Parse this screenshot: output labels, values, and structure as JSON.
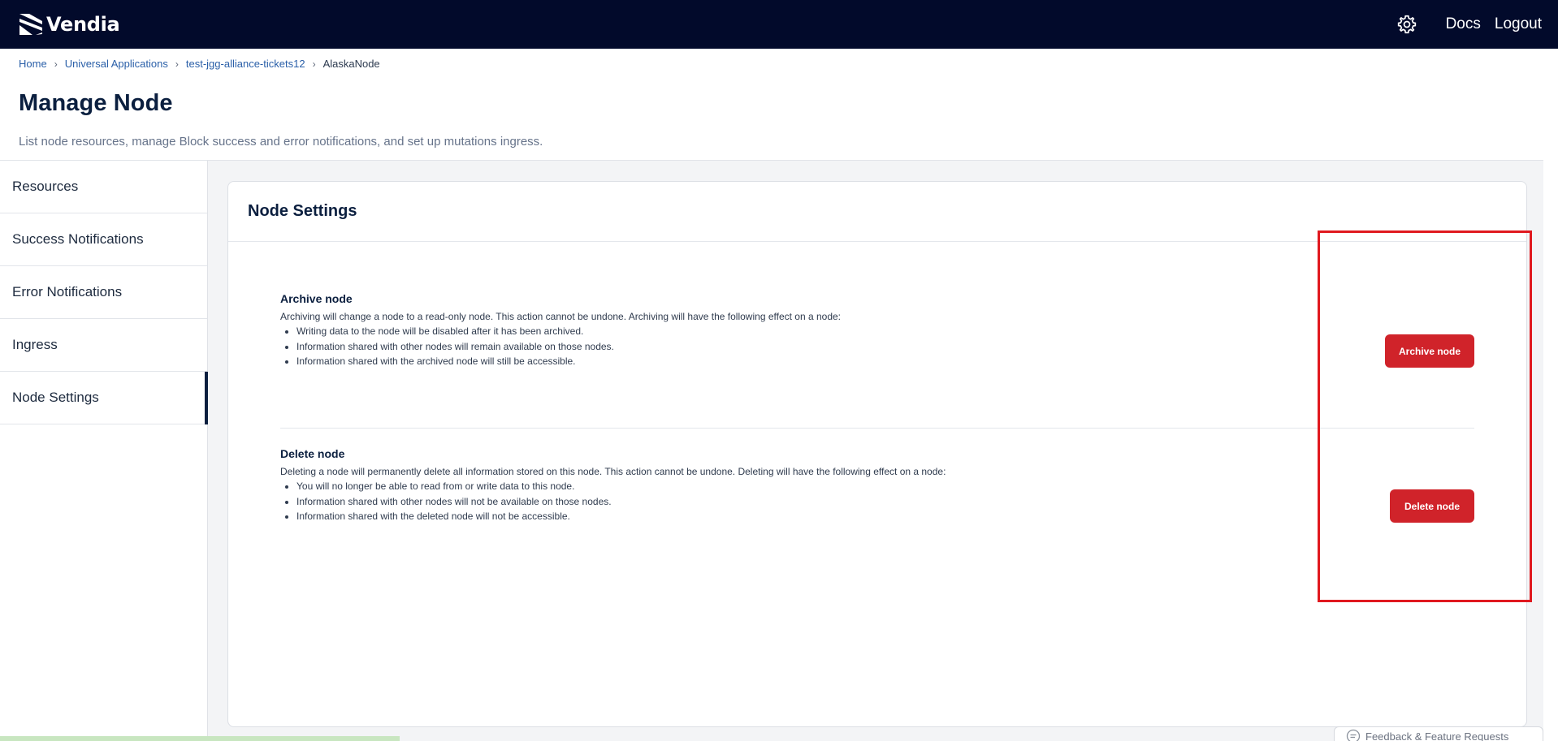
{
  "brand": {
    "name": "Vendia"
  },
  "topnav": {
    "docs": "Docs",
    "logout": "Logout",
    "settings_icon": "gear-icon"
  },
  "breadcrumb": [
    {
      "label": "Home"
    },
    {
      "label": "Universal Applications"
    },
    {
      "label": "test-jgg-alliance-tickets12"
    },
    {
      "label": "AlaskaNode"
    }
  ],
  "breadcrumb_separator": "›",
  "page": {
    "title": "Manage Node",
    "subtitle": "List node resources, manage Block success and error notifications, and set up mutations ingress."
  },
  "sidebar": {
    "items": [
      {
        "label": "Resources"
      },
      {
        "label": "Success Notifications"
      },
      {
        "label": "Error Notifications"
      },
      {
        "label": "Ingress"
      },
      {
        "label": "Node Settings",
        "active": true
      }
    ]
  },
  "card": {
    "title": "Node Settings",
    "archive": {
      "title": "Archive node",
      "description": "Archiving will change a node to a read-only node. This action cannot be undone. Archiving will have the following effect on a node:",
      "effects": [
        "Writing data to the node will be disabled after it has been archived.",
        "Information shared with other nodes will remain available on those nodes.",
        "Information shared with the archived node will still be accessible."
      ],
      "button": "Archive node"
    },
    "delete": {
      "title": "Delete node",
      "description": "Deleting a node will permanently delete all information stored on this node. This action cannot be undone. Deleting will have the following effect on a node:",
      "effects": [
        "You will no longer be able to read from or write data to this node.",
        "Information shared with other nodes will not be available on those nodes.",
        "Information shared with the deleted node will not be accessible."
      ],
      "button": "Delete node"
    }
  },
  "feedback": {
    "label": "Feedback & Feature Requests"
  },
  "colors": {
    "navbar": "#020a2b",
    "danger": "#d0232a",
    "highlight": "#e0191f",
    "link": "#2a5fa8"
  }
}
